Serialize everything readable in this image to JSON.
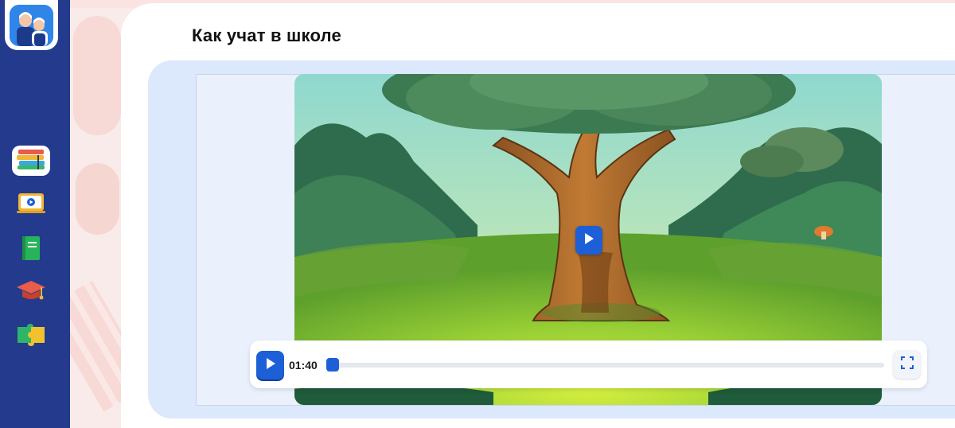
{
  "page": {
    "title": "Как учат в школе"
  },
  "sidebar": {
    "items": [
      {
        "icon": "books-icon",
        "active": true
      },
      {
        "icon": "video-lesson-icon",
        "active": false
      },
      {
        "icon": "notebook-icon",
        "active": false
      },
      {
        "icon": "graduation-cap-icon",
        "active": false
      },
      {
        "icon": "puzzle-icon",
        "active": false
      }
    ]
  },
  "player": {
    "current_time": "01:40",
    "progress": 0.0,
    "play_icon": "play-icon",
    "fullscreen_icon": "fullscreen-icon"
  },
  "colors": {
    "sidebar": "#233a8d",
    "accent": "#1d5fd6",
    "panel": "#dce8fb"
  }
}
